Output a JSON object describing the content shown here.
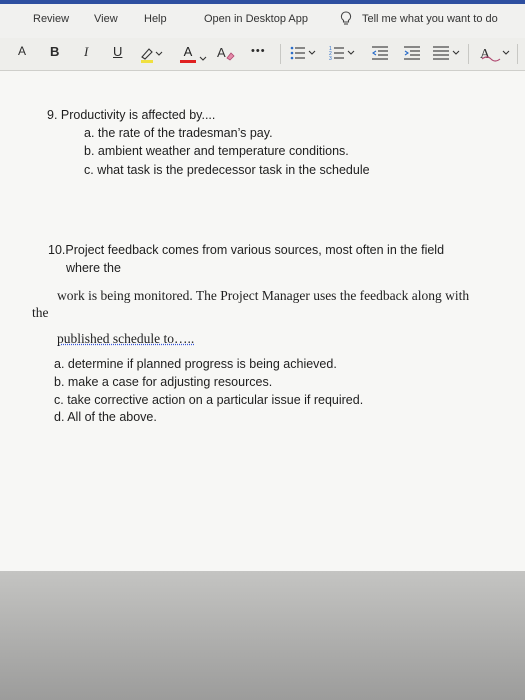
{
  "menu": {
    "review": "Review",
    "view": "View",
    "help": "Help",
    "open_desktop": "Open in Desktop App",
    "tell_me": "Tell me what you want to do"
  },
  "toolbar": {
    "font_size": "A",
    "bold": "B",
    "italic": "I",
    "underline": "U",
    "font_color": "A",
    "more": "•••"
  },
  "document": {
    "q9": {
      "question": "9. Productivity is affected by....",
      "options": [
        "a.  the rate of the tradesman’s pay.",
        "b.  ambient weather and temperature conditions.",
        "c.  what task is the predecessor task in the schedule"
      ]
    },
    "q10": {
      "line1": "10.Project feedback comes from various sources, most often in the field",
      "line2": "where the",
      "line3": "work is being monitored. The Project Manager uses the feedback along with",
      "line4": "the",
      "line5": "published schedule to…..",
      "options": [
        "a.  determine if planned progress is being achieved.",
        "b.  make a case for adjusting resources.",
        "c.  take corrective action on a particular issue if required.",
        "d.  All of the above."
      ]
    }
  }
}
